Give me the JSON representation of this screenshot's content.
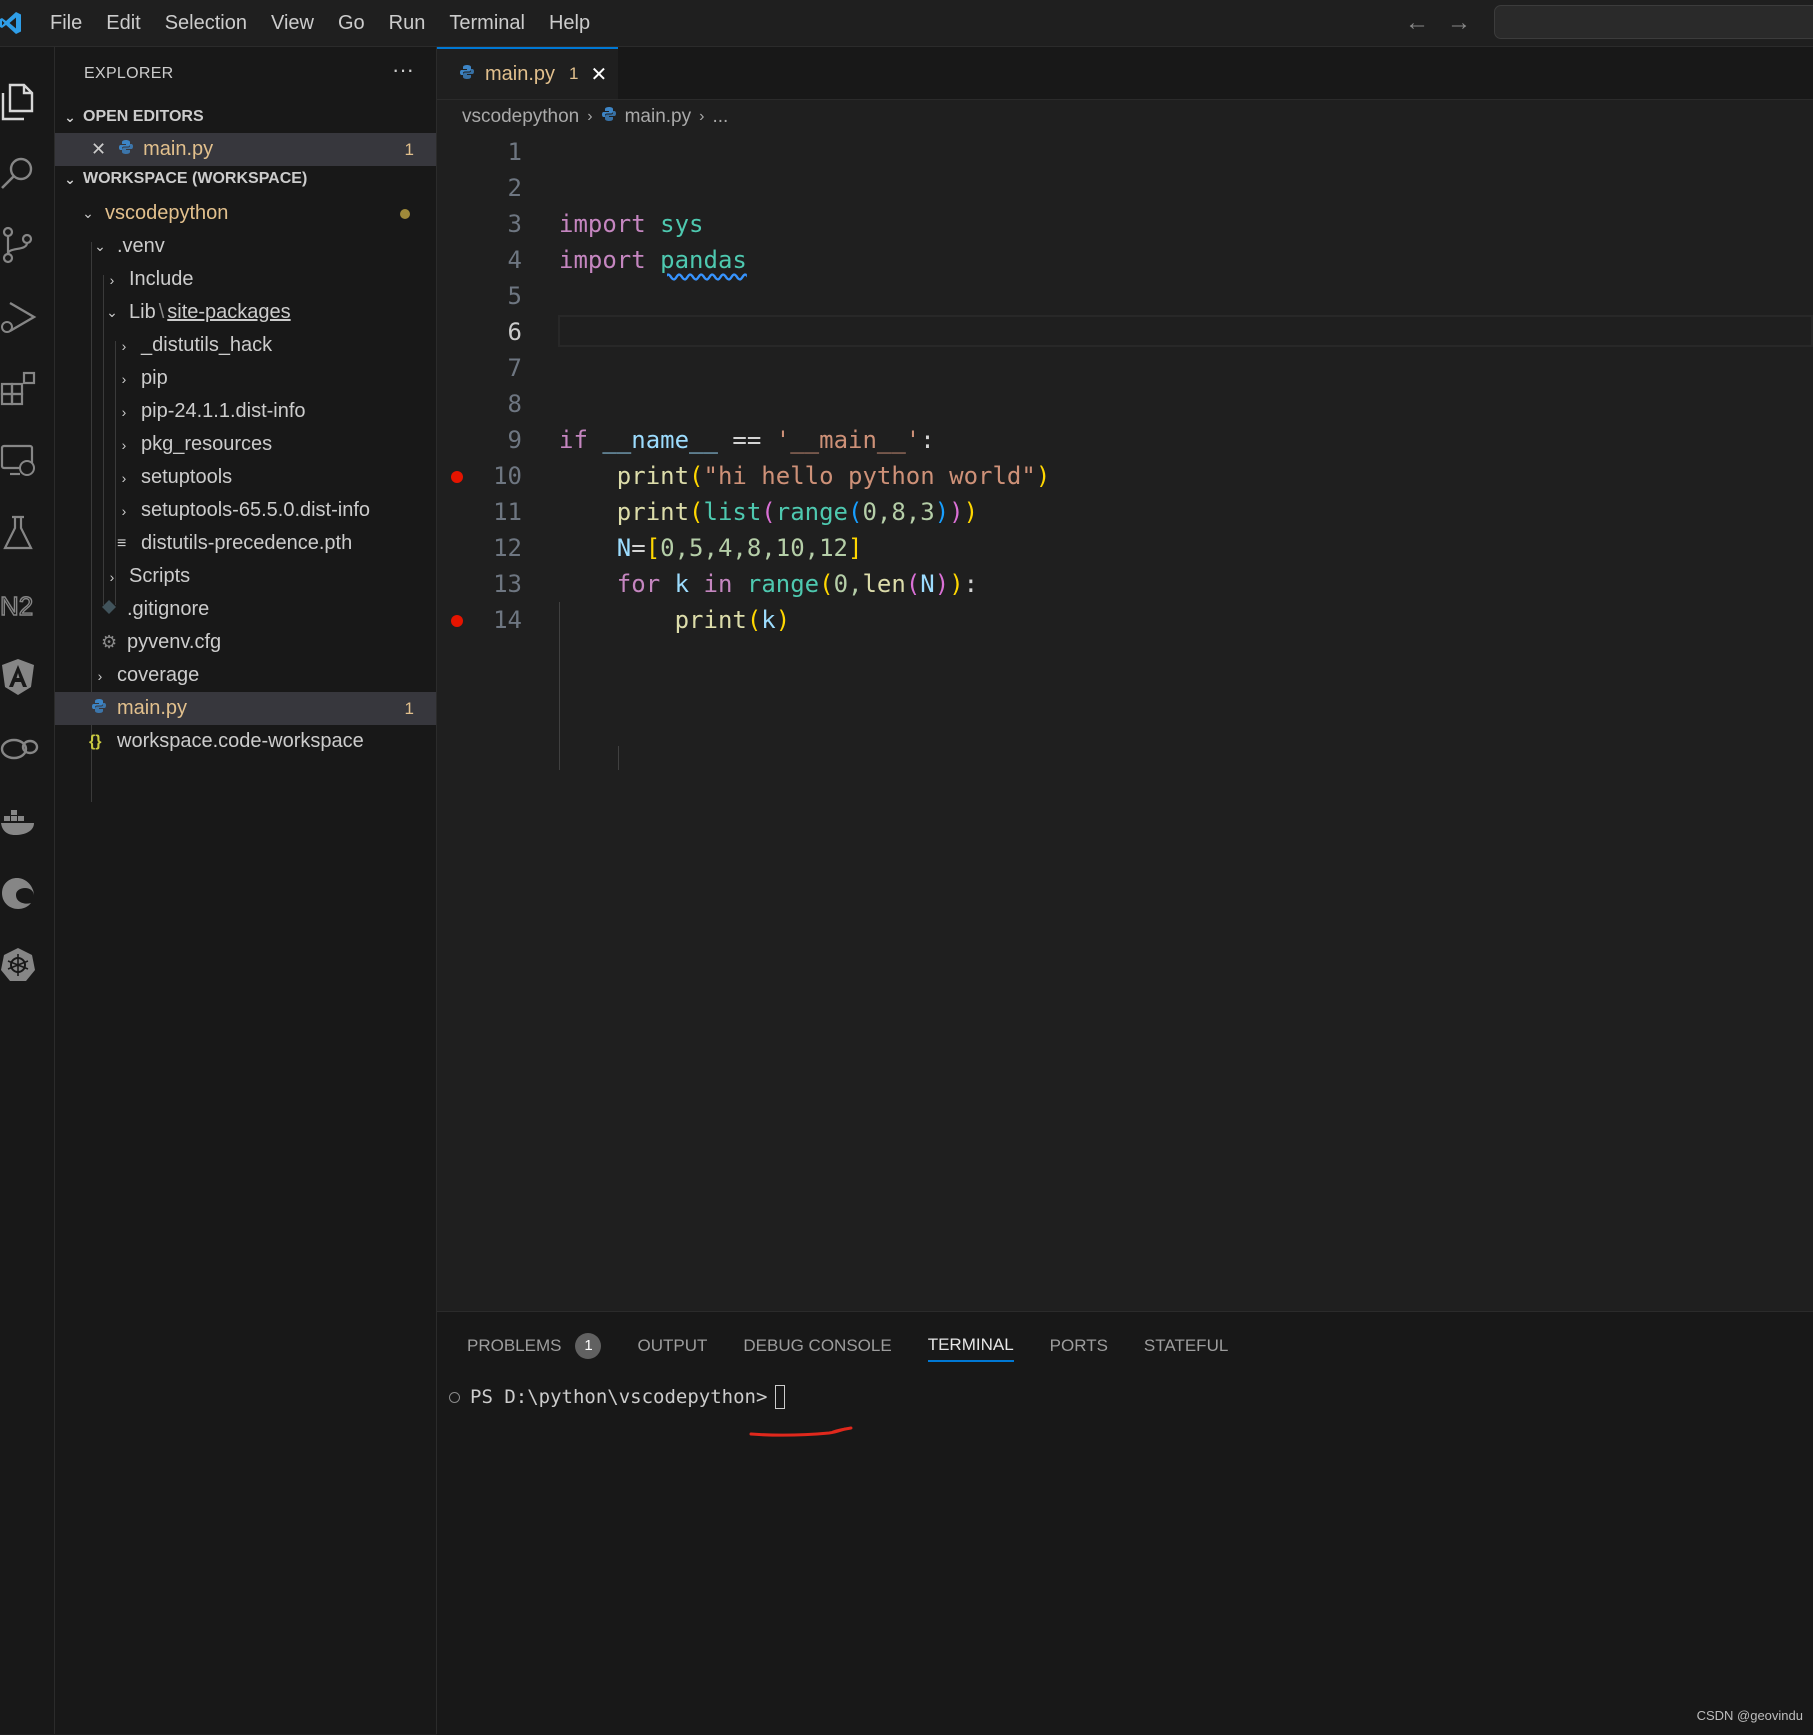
{
  "menu": [
    "File",
    "Edit",
    "Selection",
    "View",
    "Go",
    "Run",
    "Terminal",
    "Help"
  ],
  "nav": {
    "back": "←",
    "forward": "→"
  },
  "explorer": {
    "header": "EXPLORER",
    "more": "···",
    "open_editors_title": "OPEN EDITORS",
    "open_editor": {
      "close": "✕",
      "name": "main.py",
      "problems": "1"
    },
    "workspace_title": "WORKSPACE (WORKSPACE)",
    "tree": {
      "root": "vscodepython",
      "venv": ".venv",
      "include": "Include",
      "lib": "Lib",
      "lib_sep": "\\",
      "site_packages": "site-packages",
      "distutils_hack": "_distutils_hack",
      "pip": "pip",
      "pip_dist": "pip-24.1.1.dist-info",
      "pkg_resources": "pkg_resources",
      "setuptools": "setuptools",
      "setuptools_dist": "setuptools-65.5.0.dist-info",
      "distutils_pth": "distutils-precedence.pth",
      "scripts": "Scripts",
      "gitignore": ".gitignore",
      "pyvenv": "pyvenv.cfg",
      "coverage": "coverage",
      "main": "main.py",
      "main_problems": "1",
      "workspace_file": "workspace.code-workspace"
    }
  },
  "tab": {
    "name": "main.py",
    "problems": "1",
    "close": "✕"
  },
  "breadcrumb": {
    "folder": "vscodepython",
    "file": "main.py",
    "more": "..."
  },
  "editor": {
    "line_numbers": [
      "1",
      "2",
      "3",
      "4",
      "5",
      "6",
      "7",
      "8",
      "9",
      "10",
      "11",
      "12",
      "13",
      "14"
    ],
    "active_line": "6",
    "breakpoint_lines": [
      "10",
      "14"
    ],
    "code": {
      "l3_kw": "import",
      "l3_mod": "sys",
      "l4_kw": "import",
      "l4_mod": "pandas",
      "l9_if": "if",
      "l9_name": "__name__",
      "l9_eq": "==",
      "l9_str": "'__main__'",
      "l9_colon": ":",
      "l10_fn": "print",
      "l10_str": "\"hi hello python world\"",
      "l11_print": "print",
      "l11_list": "list",
      "l11_range": "range",
      "l11_args": "0,8,3",
      "l12_var": "N",
      "l12_eq": "=",
      "l12_vals": "0,5,4,8,10,12",
      "l13_for": "for",
      "l13_k": "k",
      "l13_in": "in",
      "l13_range": "range",
      "l13_zero": "0,",
      "l13_len": "len",
      "l13_N": "N",
      "l13_colon": ":",
      "l14_fn": "print",
      "l14_k": "k"
    }
  },
  "panel": {
    "tabs": {
      "problems": "PROBLEMS",
      "problems_count": "1",
      "output": "OUTPUT",
      "debug": "DEBUG CONSOLE",
      "terminal": "TERMINAL",
      "ports": "PORTS",
      "stateful": "STATEFUL"
    },
    "terminal_prompt": "PS D:\\python\\vscodepython>"
  },
  "watermark": "CSDN @geovindu",
  "colors": {
    "accent": "#0078d4",
    "modified": "#e2c08d",
    "breakpoint": "#e51400",
    "annotation": "#e0281c"
  }
}
